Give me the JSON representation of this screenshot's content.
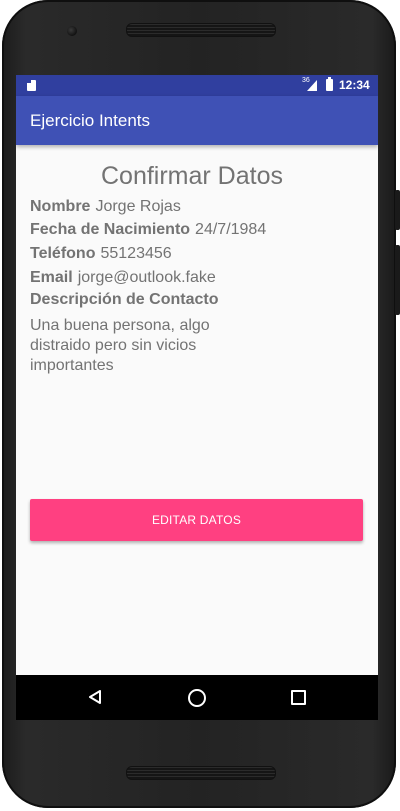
{
  "status_bar": {
    "network": "36",
    "time": "12:34"
  },
  "app_bar": {
    "title": "Ejercicio Intents"
  },
  "screen": {
    "heading": "Confirmar Datos",
    "fields": [
      {
        "label": "Nombre",
        "value": "Jorge Rojas"
      },
      {
        "label": "Fecha de Nacimiento",
        "value": "24/7/1984"
      },
      {
        "label": "Teléfono",
        "value": "55123456"
      },
      {
        "label": "Email",
        "value": "jorge@outlook.fake"
      }
    ],
    "description_label": "Descripción de Contacto",
    "description_text": "Una buena persona, algo distraido pero sin vicios importantes",
    "edit_button": "EDITAR DATOS"
  },
  "colors": {
    "status_bar": "#303f9f",
    "app_bar": "#3f51b5",
    "accent": "#ff4081",
    "text": "#737373"
  },
  "nav_bar": {
    "icons": [
      "back-icon",
      "home-icon",
      "recents-icon"
    ]
  }
}
